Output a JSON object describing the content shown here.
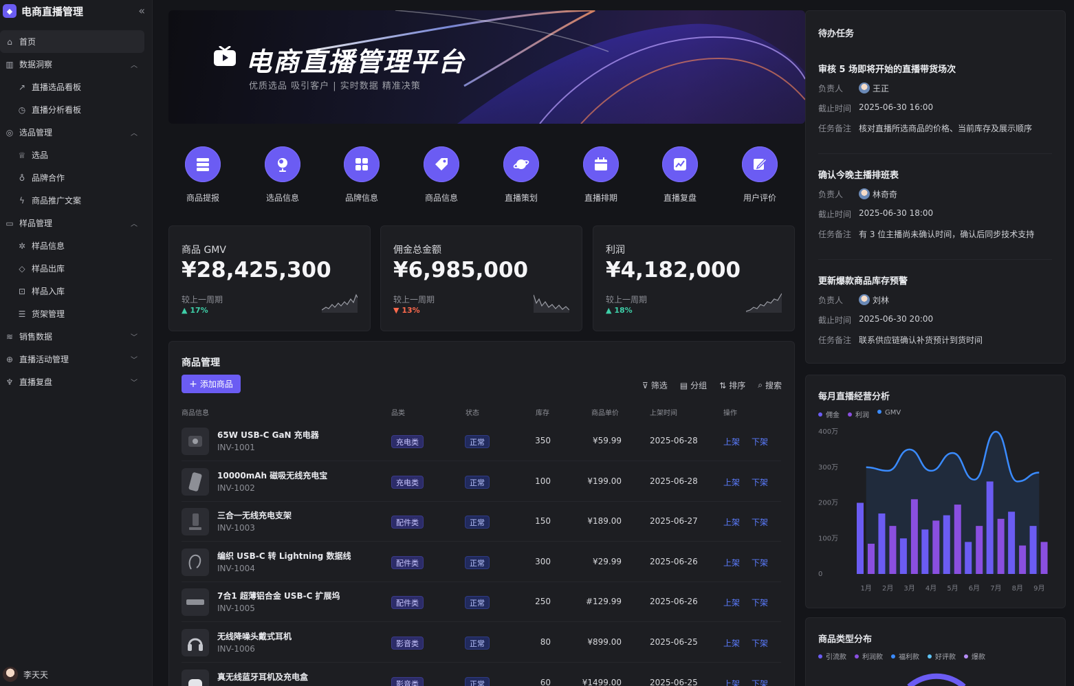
{
  "sidebar": {
    "brand": "电商直播管理",
    "items": [
      {
        "label": "首页",
        "icon": "home-icon"
      },
      {
        "label": "数据洞察",
        "icon": "chart-icon"
      },
      {
        "label": "直播选品看板",
        "icon": "trend-icon"
      },
      {
        "label": "直播分析看板",
        "icon": "clock-icon"
      },
      {
        "label": "选品管理",
        "icon": "compass-icon"
      },
      {
        "label": "选品",
        "icon": "trophy-icon"
      },
      {
        "label": "品牌合作",
        "icon": "bulb-icon"
      },
      {
        "label": "商品推广文案",
        "icon": "bolt-icon"
      },
      {
        "label": "样品管理",
        "icon": "gallery-icon"
      },
      {
        "label": "样品信息",
        "icon": "badge-icon"
      },
      {
        "label": "样品出库",
        "icon": "tag-icon"
      },
      {
        "label": "样品入库",
        "icon": "inbox-icon"
      },
      {
        "label": "货架管理",
        "icon": "shelf-icon"
      },
      {
        "label": "销售数据",
        "icon": "layers-icon"
      },
      {
        "label": "直播活动管理",
        "icon": "target-icon"
      },
      {
        "label": "直播复盘",
        "icon": "lamp-icon"
      }
    ],
    "user": "李天天"
  },
  "banner": {
    "title": "电商直播管理平台",
    "subtitle": "优质选品 吸引客户 | 实时数据 精准决策"
  },
  "quick": [
    {
      "label": "商品提报",
      "icon": "server-icon"
    },
    {
      "label": "选品信息",
      "icon": "globe-icon"
    },
    {
      "label": "品牌信息",
      "icon": "grid-icon"
    },
    {
      "label": "商品信息",
      "icon": "tag-icon"
    },
    {
      "label": "直播策划",
      "icon": "planet-icon"
    },
    {
      "label": "直播排期",
      "icon": "calendar-icon"
    },
    {
      "label": "直播复盘",
      "icon": "chart-up-icon"
    },
    {
      "label": "用户评价",
      "icon": "edit-icon"
    }
  ],
  "stats": [
    {
      "title": "商品 GMV",
      "value": "¥28,425,300",
      "compare": "较上一周期",
      "pct": "17%",
      "dir": "up",
      "arrow": "▲"
    },
    {
      "title": "佣金总金额",
      "value": "¥6,985,000",
      "compare": "较上一周期",
      "pct": "13%",
      "dir": "down",
      "arrow": "▼"
    },
    {
      "title": "利润",
      "value": "¥4,182,000",
      "compare": "较上一周期",
      "pct": "18%",
      "dir": "up",
      "arrow": "▲"
    }
  ],
  "products": {
    "title": "商品管理",
    "add": "添加商品",
    "tools": [
      "筛选",
      "分组",
      "排序",
      "搜索"
    ],
    "headers": [
      "商品信息",
      "品类",
      "状态",
      "库存",
      "商品单价",
      "上架时间",
      "操作"
    ],
    "rows": [
      {
        "name": "65W USB-C GaN 充电器",
        "sku": "INV-1001",
        "cat": "充电类",
        "status": "正常",
        "stock": "350",
        "price": "¥59.99",
        "date": "2025-06-28",
        "on": "上架",
        "off": "下架"
      },
      {
        "name": "10000mAh 磁吸无线充电宝",
        "sku": "INV-1002",
        "cat": "充电类",
        "status": "正常",
        "stock": "100",
        "price": "¥199.00",
        "date": "2025-06-28",
        "on": "上架",
        "off": "下架"
      },
      {
        "name": "三合一无线充电支架",
        "sku": "INV-1003",
        "cat": "配件类",
        "status": "正常",
        "stock": "150",
        "price": "¥189.00",
        "date": "2025-06-27",
        "on": "上架",
        "off": "下架"
      },
      {
        "name": "编织 USB-C 转 Lightning 数据线",
        "sku": "INV-1004",
        "cat": "配件类",
        "status": "正常",
        "stock": "300",
        "price": "¥29.99",
        "date": "2025-06-26",
        "on": "上架",
        "off": "下架"
      },
      {
        "name": "7合1 超薄铝合金 USB-C 扩展坞",
        "sku": "INV-1005",
        "cat": "配件类",
        "status": "正常",
        "stock": "250",
        "price": "#129.99",
        "date": "2025-06-26",
        "on": "上架",
        "off": "下架"
      },
      {
        "name": "无线降噪头戴式耳机",
        "sku": "INV-1006",
        "cat": "影音类",
        "status": "正常",
        "stock": "80",
        "price": "¥899.00",
        "date": "2025-06-25",
        "on": "上架",
        "off": "下架"
      },
      {
        "name": "真无线蓝牙耳机及充电盒",
        "sku": "",
        "cat": "影音类",
        "status": "正常",
        "stock": "60",
        "price": "¥1499.00",
        "date": "2025-06-25",
        "on": "上架",
        "off": "下架"
      }
    ]
  },
  "todo": {
    "title": "待办任务",
    "tasks": [
      {
        "title": "审核 5 场即将开始的直播带货场次",
        "owner_k": "负责人",
        "owner": "王正",
        "due_k": "截止时间",
        "due": "2025-06-30 16:00",
        "note_k": "任务备注",
        "note": "核对直播所选商品的价格、当前库存及展示顺序"
      },
      {
        "title": "确认今晚主播排班表",
        "owner_k": "负责人",
        "owner": "林奇奇",
        "due_k": "截止时间",
        "due": "2025-06-30 18:00",
        "note_k": "任务备注",
        "note": "有 3 位主播尚未确认时间，确认后同步技术支持"
      },
      {
        "title": "更新爆款商品库存预警",
        "owner_k": "负责人",
        "owner": "刘林",
        "due_k": "截止时间",
        "due": "2025-06-30 20:00",
        "note_k": "任务备注",
        "note": "联系供应链确认补货预计到货时间"
      }
    ]
  },
  "monthly": {
    "title": "每月直播经营分析",
    "legend": [
      "佣金",
      "利润",
      "GMV"
    ],
    "colors": {
      "commission": "#6b5cf3",
      "profit": "#8a4fe0",
      "gmv": "#3a8bff"
    }
  },
  "distribution": {
    "title": "商品类型分布",
    "legend": [
      "引流款",
      "利润款",
      "福利款",
      "好评款",
      "爆款"
    ],
    "colors": [
      "#6b5cf3",
      "#8a4fe0",
      "#3a8bff",
      "#5ec4f5",
      "#b58cf5"
    ]
  },
  "chart_data": {
    "type": "bar",
    "title": "每月直播经营分析",
    "categories": [
      "1月",
      "2月",
      "3月",
      "4月",
      "5月",
      "6月",
      "7月",
      "8月",
      "9月"
    ],
    "ylim": [
      0,
      400
    ],
    "yticks": [
      "0",
      "100万",
      "200万",
      "300万",
      "400万"
    ],
    "series": [
      {
        "name": "佣金",
        "type": "bar",
        "values": [
          200,
          170,
          100,
          125,
          165,
          90,
          260,
          175,
          135
        ]
      },
      {
        "name": "利润",
        "type": "bar",
        "values": [
          85,
          135,
          210,
          150,
          195,
          135,
          155,
          80,
          90
        ]
      },
      {
        "name": "GMV",
        "type": "line",
        "values": [
          300,
          290,
          350,
          290,
          340,
          265,
          400,
          260,
          285
        ]
      }
    ]
  }
}
